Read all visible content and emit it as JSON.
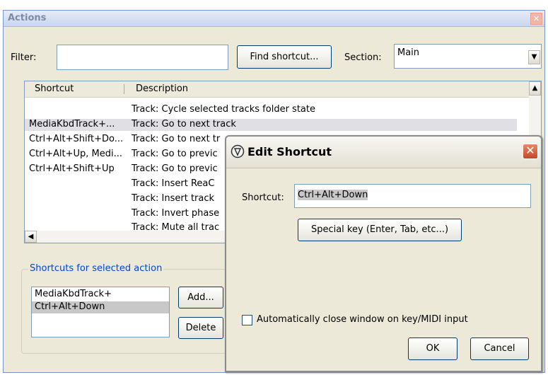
{
  "actions_window": {
    "title": "Actions",
    "filter_label": "Filter:",
    "filter_value": "",
    "find_shortcut_button": "Find shortcut...",
    "section_label": "Section:",
    "section_value": "Main",
    "columns": [
      "Shortcut",
      "Description"
    ],
    "rows": [
      {
        "shortcut": "",
        "description": "Track: Cycle selected tracks folder state"
      },
      {
        "shortcut": "MediaKbdTrack+...",
        "description": "Track: Go to next track"
      },
      {
        "shortcut": "Ctrl+Alt+Shift+Do...",
        "description": "Track: Go to next tr"
      },
      {
        "shortcut": "Ctrl+Alt+Up, Medi...",
        "description": "Track: Go to previc"
      },
      {
        "shortcut": "Ctrl+Alt+Shift+Up",
        "description": "Track: Go to previc"
      },
      {
        "shortcut": "",
        "description": "Track: Insert ReaC"
      },
      {
        "shortcut": "",
        "description": "Track: Insert track"
      },
      {
        "shortcut": "",
        "description": "Track: Invert phase"
      },
      {
        "shortcut": "",
        "description": "Track: Mute all trac"
      }
    ],
    "shortcuts_group_title": "Shortcuts for selected action",
    "selected_shortcuts": [
      "MediaKbdTrack+",
      "Ctrl+Alt+Down"
    ],
    "add_button": "Add...",
    "delete_button": "Delete"
  },
  "edit_shortcut_dialog": {
    "title": "Edit Shortcut",
    "shortcut_label": "Shortcut:",
    "shortcut_value": "Ctrl+Alt+Down",
    "special_key_button": "Special key (Enter, Tab, etc...)",
    "auto_close_checkbox_label": "Automatically close window on key/MIDI input",
    "auto_close_checked": false,
    "ok_button": "OK",
    "cancel_button": "Cancel"
  },
  "icons": {
    "close": "close-icon",
    "scroll_up": "arrow-up-icon",
    "scroll_left": "arrow-left-icon",
    "dropdown": "chevron-down-icon",
    "app": "reaper-icon"
  }
}
